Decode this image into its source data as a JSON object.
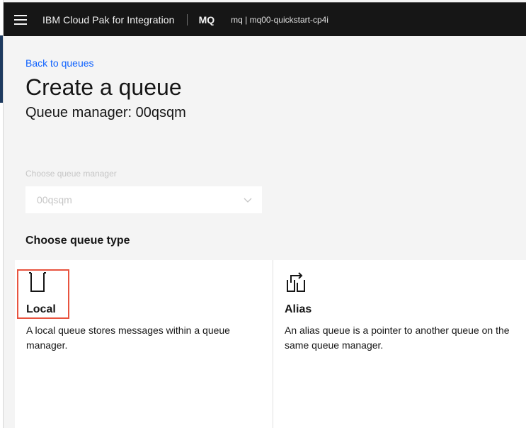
{
  "header": {
    "product_name": "IBM Cloud Pak for Integration",
    "app_name": "MQ",
    "instance": "mq | mq00-quickstart-cp4i"
  },
  "page": {
    "back_link": "Back to queues",
    "title": "Create a queue",
    "subtitle": "Queue manager: 00qsqm"
  },
  "queue_manager_field": {
    "label": "Choose queue manager",
    "value": "00qsqm",
    "disabled": true
  },
  "queue_type": {
    "title": "Choose queue type",
    "tiles": [
      {
        "icon": "local-queue-icon",
        "name": "Local",
        "description": "A local queue stores messages within a queue manager.",
        "highlighted": true
      },
      {
        "icon": "alias-queue-icon",
        "name": "Alias",
        "description": "An alias queue is a pointer to another queue on the same queue manager."
      }
    ]
  },
  "colors": {
    "header_bg": "#161616",
    "page_bg": "#f4f4f4",
    "link": "#0f62fe",
    "highlight": "#e8533f"
  }
}
